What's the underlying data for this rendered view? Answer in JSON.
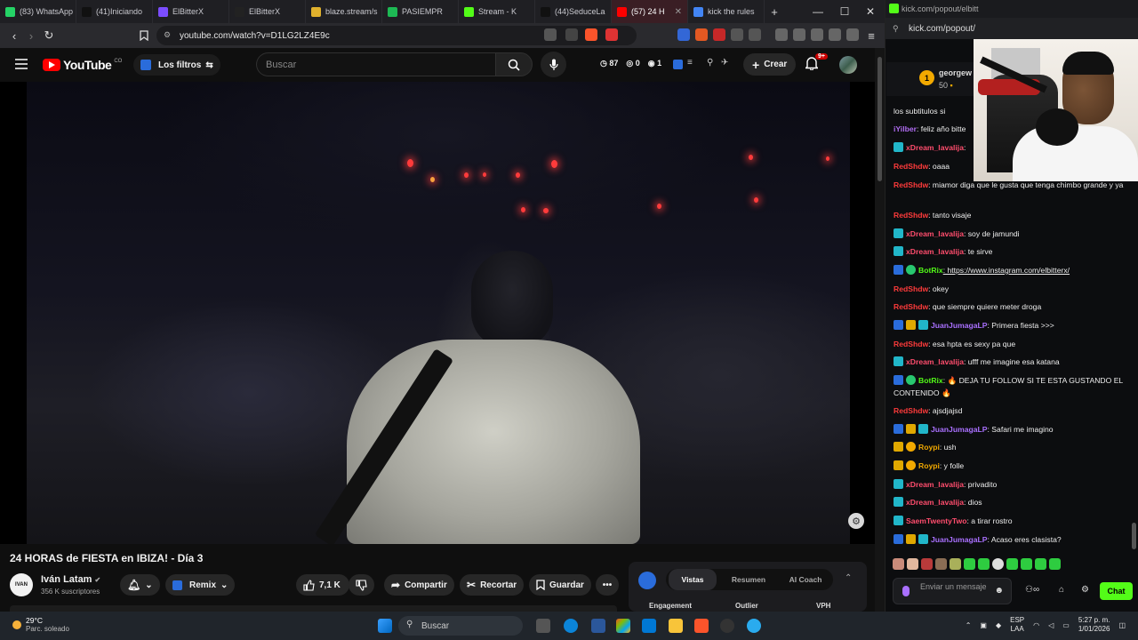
{
  "browser": {
    "tabs": [
      {
        "label": "(83) WhatsApp",
        "color": "#25d366"
      },
      {
        "label": "(41)Iniciando",
        "color": "#111111"
      },
      {
        "label": "ElBitterX",
        "color": "#7b4dff"
      },
      {
        "label": "ElBitterX",
        "color": "#222222"
      },
      {
        "label": "blaze.stream/s",
        "color": "#e0b12d"
      },
      {
        "label": "PASIEMPR",
        "color": "#1db954"
      },
      {
        "label": "Stream - K",
        "color": "#53fc18"
      },
      {
        "label": "(44)SeduceLa",
        "color": "#111111"
      },
      {
        "label": "(57) 24 H",
        "color": "#ff0000"
      },
      {
        "label": "kick the rules",
        "color": "#4285f4"
      }
    ],
    "new_tab": "+",
    "url": "youtube.com/watch?v=D1LG2LZ4E9c"
  },
  "youtube": {
    "logo_text": "YouTube",
    "logo_suffix": "CO",
    "filters_label": "Los filtros",
    "search_placeholder": "Buscar",
    "stats": [
      "87",
      "0",
      "1"
    ],
    "create_label": "Crear",
    "notif_badge": "9+",
    "video_title": "24 HORAS de FIESTA en IBIZA! - Día 3",
    "channel_name": "Iván Latam",
    "channel_avatar_text": "IVAN",
    "channel_subs": "356 K suscriptores",
    "remix_label": "Remix",
    "likes": "7,1 K",
    "share_label": "Compartir",
    "clip_label": "Recortar",
    "save_label": "Guardar",
    "analytics_tabs": [
      "Vistas",
      "Resumen",
      "AI Coach"
    ],
    "analytics_cols": [
      "Engagement",
      "Outlier",
      "VPH"
    ]
  },
  "kick": {
    "top_url": "kick.com/popout/elbitt",
    "url": "kick.com/popout/",
    "pinned_user": "georgew",
    "pinned_amount": "50",
    "pinned_rank": "1",
    "messages": [
      {
        "user": "",
        "text": "los subtitulos si",
        "color": "#eeeeee",
        "badges": []
      },
      {
        "user": "iYilber",
        "text": ": feliz año bitte",
        "color": "#b06cf2",
        "badges": []
      },
      {
        "user": "xDream_lavalija",
        "text": ":",
        "color": "#ff4d6d",
        "badges": [
          "cyan"
        ]
      },
      {
        "user": "RedShdw",
        "text": ": oaaa",
        "color": "#ff3b3b",
        "badges": []
      },
      {
        "user": "RedShdw",
        "text": ": miamor diga que le gusta que tenga chimbo grande y ya",
        "color": "#ff3b3b",
        "badges": []
      },
      {
        "user": "RedShdw",
        "text": ": tanto visaje",
        "color": "#ff3b3b",
        "badges": []
      },
      {
        "user": "xDream_lavalija",
        "text": ": soy de jamundi",
        "color": "#ff4d6d",
        "badges": [
          "cyan"
        ]
      },
      {
        "user": "xDream_lavalija",
        "text": ": te sirve",
        "color": "#ff4d6d",
        "badges": [
          "cyan"
        ]
      },
      {
        "user": "BotRix",
        "text": ": https://www.instagram.com/elbitterx/",
        "color": "#53fc18",
        "badges": [
          "blue",
          "green"
        ]
      },
      {
        "user": "RedShdw",
        "text": ": okey",
        "color": "#ff3b3b",
        "badges": []
      },
      {
        "user": "RedShdw",
        "text": ": que siempre quiere meter droga",
        "color": "#ff3b3b",
        "badges": []
      },
      {
        "user": "JuanJumagaLP",
        "text": ": Primera fiesta >>>",
        "color": "#a970ff",
        "badges": [
          "blue",
          "gold",
          "cyan"
        ]
      },
      {
        "user": "RedShdw",
        "text": ": esa hpta es sexy pa que",
        "color": "#ff3b3b",
        "badges": []
      },
      {
        "user": "xDream_lavalija",
        "text": ": ufff me imagine esa katana",
        "color": "#ff4d6d",
        "badges": [
          "cyan"
        ]
      },
      {
        "user": "BotRix",
        "text": ": 🔥 DEJA TU FOLLOW SI TE ESTA GUSTANDO EL CONTENIDO 🔥",
        "color": "#53fc18",
        "badges": [
          "blue",
          "green"
        ]
      },
      {
        "user": "RedShdw",
        "text": ": ajsdjajsd",
        "color": "#ff3b3b",
        "badges": []
      },
      {
        "user": "JuanJumagaLP",
        "text": ": Safari me imagino",
        "color": "#a970ff",
        "badges": [
          "blue",
          "gold",
          "cyan"
        ]
      },
      {
        "user": "Roypi",
        "text": ": ush",
        "color": "#f2a900",
        "badges": [
          "gold",
          "coin"
        ]
      },
      {
        "user": "Roypi",
        "text": ": y folle",
        "color": "#f2a900",
        "badges": [
          "gold",
          "coin"
        ]
      },
      {
        "user": "xDream_lavalija",
        "text": ": privadito",
        "color": "#ff4d6d",
        "badges": [
          "cyan"
        ]
      },
      {
        "user": "xDream_lavalija",
        "text": ": dios",
        "color": "#ff4d6d",
        "badges": [
          "cyan"
        ]
      },
      {
        "user": "SaemTwentyTwo",
        "text": ": a tirar rostro",
        "color": "#ff4d6d",
        "badges": [
          "cyan"
        ]
      },
      {
        "user": "JuanJumagaLP",
        "text": ": Acaso eres clasista?",
        "color": "#a970ff",
        "badges": [
          "blue",
          "gold",
          "cyan"
        ]
      }
    ],
    "input_placeholder": "Enviar un mensaje",
    "chat_button": "Chat"
  },
  "taskbar": {
    "temp": "29°C",
    "weather": "Parc. soleado",
    "search": "Buscar",
    "lang": "ESP",
    "lang2": "LAA",
    "time": "5:27 p. m.",
    "date": "1/01/2026"
  }
}
